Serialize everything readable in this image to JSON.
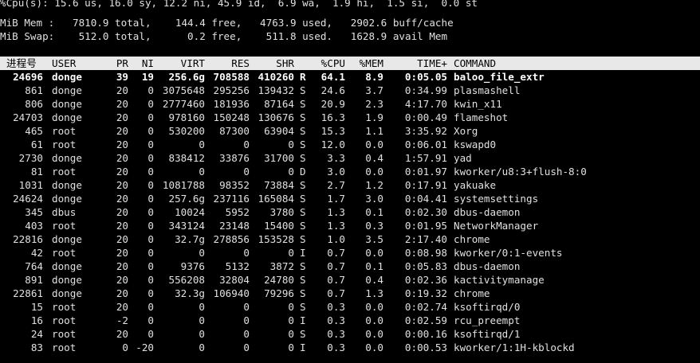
{
  "summary": {
    "cpu": "%Cpu(s): 15.6 us, 16.0 sy, 12.2 ni, 45.9 id,  6.9 wa,  1.9 hi,  1.5 si,  0.0 st",
    "mem": "MiB Mem :   7810.9 total,    144.4 free,   4763.9 used,   2902.6 buff/cache",
    "swap": "MiB Swap:    512.0 total,      0.2 free,    511.8 used.   1628.9 avail Mem"
  },
  "columns": [
    "进程号",
    "USER",
    "PR",
    "NI",
    "VIRT",
    "RES",
    "SHR",
    "",
    "%CPU",
    "%MEM",
    "TIME+",
    "COMMAND"
  ],
  "processes": [
    [
      "24696",
      "donge",
      "39",
      "19",
      "256.6g",
      "708588",
      "410260",
      "R",
      "64.1",
      "8.9",
      "0:05.05",
      "baloo_file_extr"
    ],
    [
      "861",
      "donge",
      "20",
      "0",
      "3075648",
      "295256",
      "139432",
      "S",
      "24.6",
      "3.7",
      "0:34.99",
      "plasmashell"
    ],
    [
      "806",
      "donge",
      "20",
      "0",
      "2777460",
      "181936",
      "87164",
      "S",
      "20.9",
      "2.3",
      "4:17.70",
      "kwin_x11"
    ],
    [
      "24703",
      "donge",
      "20",
      "0",
      "978160",
      "150248",
      "130676",
      "S",
      "16.3",
      "1.9",
      "0:00.49",
      "flameshot"
    ],
    [
      "465",
      "root",
      "20",
      "0",
      "530200",
      "87300",
      "63904",
      "S",
      "15.3",
      "1.1",
      "3:35.92",
      "Xorg"
    ],
    [
      "61",
      "root",
      "20",
      "0",
      "0",
      "0",
      "0",
      "S",
      "12.0",
      "0.0",
      "0:06.01",
      "kswapd0"
    ],
    [
      "2730",
      "donge",
      "20",
      "0",
      "838412",
      "33876",
      "31700",
      "S",
      "3.3",
      "0.4",
      "1:57.91",
      "yad"
    ],
    [
      "81",
      "root",
      "20",
      "0",
      "0",
      "0",
      "0",
      "D",
      "3.0",
      "0.0",
      "0:01.97",
      "kworker/u8:3+flush-8:0"
    ],
    [
      "1031",
      "donge",
      "20",
      "0",
      "1081788",
      "98352",
      "73884",
      "S",
      "2.7",
      "1.2",
      "0:17.91",
      "yakuake"
    ],
    [
      "24624",
      "donge",
      "20",
      "0",
      "257.6g",
      "237116",
      "165084",
      "S",
      "1.7",
      "3.0",
      "0:04.41",
      "systemsettings"
    ],
    [
      "345",
      "dbus",
      "20",
      "0",
      "10024",
      "5952",
      "3780",
      "S",
      "1.3",
      "0.1",
      "0:02.30",
      "dbus-daemon"
    ],
    [
      "403",
      "root",
      "20",
      "0",
      "343124",
      "23148",
      "15400",
      "S",
      "1.3",
      "0.3",
      "0:01.95",
      "NetworkManager"
    ],
    [
      "22816",
      "donge",
      "20",
      "0",
      "32.7g",
      "278856",
      "153528",
      "S",
      "1.0",
      "3.5",
      "2:17.40",
      "chrome"
    ],
    [
      "42",
      "root",
      "20",
      "0",
      "0",
      "0",
      "0",
      "I",
      "0.7",
      "0.0",
      "0:08.98",
      "kworker/0:1-events"
    ],
    [
      "764",
      "donge",
      "20",
      "0",
      "9376",
      "5132",
      "3872",
      "S",
      "0.7",
      "0.1",
      "0:05.83",
      "dbus-daemon"
    ],
    [
      "891",
      "donge",
      "20",
      "0",
      "556208",
      "32804",
      "24780",
      "S",
      "0.7",
      "0.4",
      "0:02.36",
      "kactivitymanage"
    ],
    [
      "22861",
      "donge",
      "20",
      "0",
      "32.3g",
      "106940",
      "79296",
      "S",
      "0.7",
      "1.3",
      "0:19.32",
      "chrome"
    ],
    [
      "15",
      "root",
      "20",
      "0",
      "0",
      "0",
      "0",
      "S",
      "0.3",
      "0.0",
      "0:02.74",
      "ksoftirqd/0"
    ],
    [
      "16",
      "root",
      "-2",
      "0",
      "0",
      "0",
      "0",
      "I",
      "0.3",
      "0.0",
      "0:02.59",
      "rcu_preempt"
    ],
    [
      "24",
      "root",
      "20",
      "0",
      "0",
      "0",
      "0",
      "S",
      "0.3",
      "0.0",
      "0:00.16",
      "ksoftirqd/1"
    ],
    [
      "83",
      "root",
      "0",
      "-20",
      "0",
      "0",
      "0",
      "I",
      "0.3",
      "0.0",
      "0:00.53",
      "kworker/1:1H-kblockd"
    ]
  ]
}
